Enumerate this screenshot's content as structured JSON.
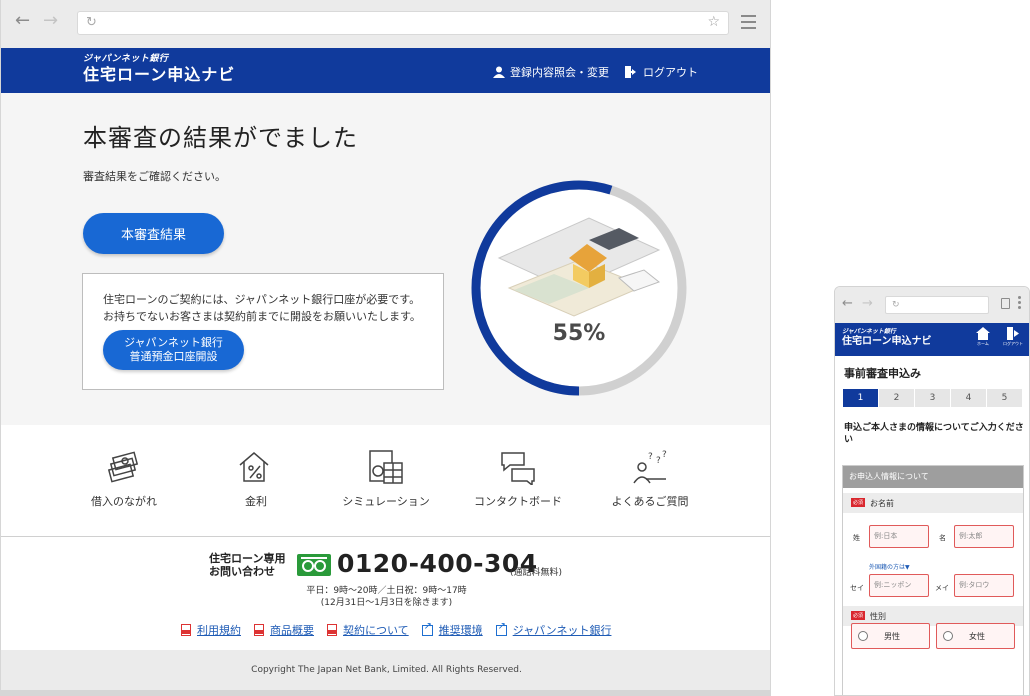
{
  "desktop": {
    "header": {
      "logo_small": "ジャパンネット銀行",
      "logo_big": "住宅ローン申込ナビ",
      "account_link": "登録内容照会・変更",
      "logout_link": "ログアウト"
    },
    "hero": {
      "title": "本審査の結果がでました",
      "subtitle": "審査結果をご確認ください。",
      "result_button": "本審査結果",
      "notice_text_1": "住宅ローンのご契約には、ジャパンネット銀行口座が必要です。",
      "notice_text_2": "お持ちでないお客さまは契約前までに開設をお願いいたします。",
      "open_button_line1": "ジャパンネット銀行",
      "open_button_line2": "普通預金口座開設",
      "progress_label": "55%",
      "progress_value": 0.55
    },
    "icons": [
      {
        "label": "借入のながれ",
        "icon": "money-stack-icon"
      },
      {
        "label": "金利",
        "icon": "house-percent-icon"
      },
      {
        "label": "シミュレーション",
        "icon": "calculator-chart-icon"
      },
      {
        "label": "コンタクトボード",
        "icon": "chat-bubbles-icon"
      },
      {
        "label": "よくあるご質問",
        "icon": "person-question-icon"
      }
    ],
    "contact": {
      "title_line1": "住宅ローン専用",
      "title_line2": "お問い合わせ",
      "tel": "0120-400-304",
      "tel_note": "(通話料無料)",
      "hours_line1": "平日：9時〜20時／土日祝：9時〜17時",
      "hours_line2": "(12月31日〜1月3日を除きます)"
    },
    "links": [
      {
        "label": "利用規約",
        "type": "pdf"
      },
      {
        "label": "商品概要",
        "type": "pdf"
      },
      {
        "label": "契約について",
        "type": "pdf"
      },
      {
        "label": "推奨環境",
        "type": "external"
      },
      {
        "label": "ジャパンネット銀行",
        "type": "external"
      }
    ],
    "footer": {
      "copyright": "Copyright The Japan Net Bank, Limited. All Rights Reserved."
    },
    "colors": {
      "brand": "#103a9c",
      "button": "#1868d4",
      "progress": "#103a9c"
    }
  },
  "mobile": {
    "header": {
      "logo_small": "ジャパンネット銀行",
      "logo_big": "住宅ローン申込ナビ",
      "home": "ホーム",
      "logout": "ログアウト"
    },
    "page_title": "事前審査申込み",
    "steps": [
      "1",
      "2",
      "3",
      "4",
      "5"
    ],
    "active_step": 1,
    "lead": "申込ご本人さまの情報についてご入力ください",
    "section_title": "お申込人情報について",
    "name_row": {
      "required": "必須",
      "label": "お名前"
    },
    "fields": {
      "sei_label": "姓",
      "sei_placeholder": "例:日本",
      "mei_label": "名",
      "mei_placeholder": "例:太郎",
      "foreign_link": "外国籍の方は▼",
      "sei_kana_label": "セイ",
      "sei_kana_placeholder": "例:ニッポン",
      "mei_kana_label": "メイ",
      "mei_kana_placeholder": "例:タロウ"
    },
    "gender_row": {
      "required": "必須",
      "label": "性別"
    },
    "gender_options": [
      "男性",
      "女性"
    ]
  }
}
